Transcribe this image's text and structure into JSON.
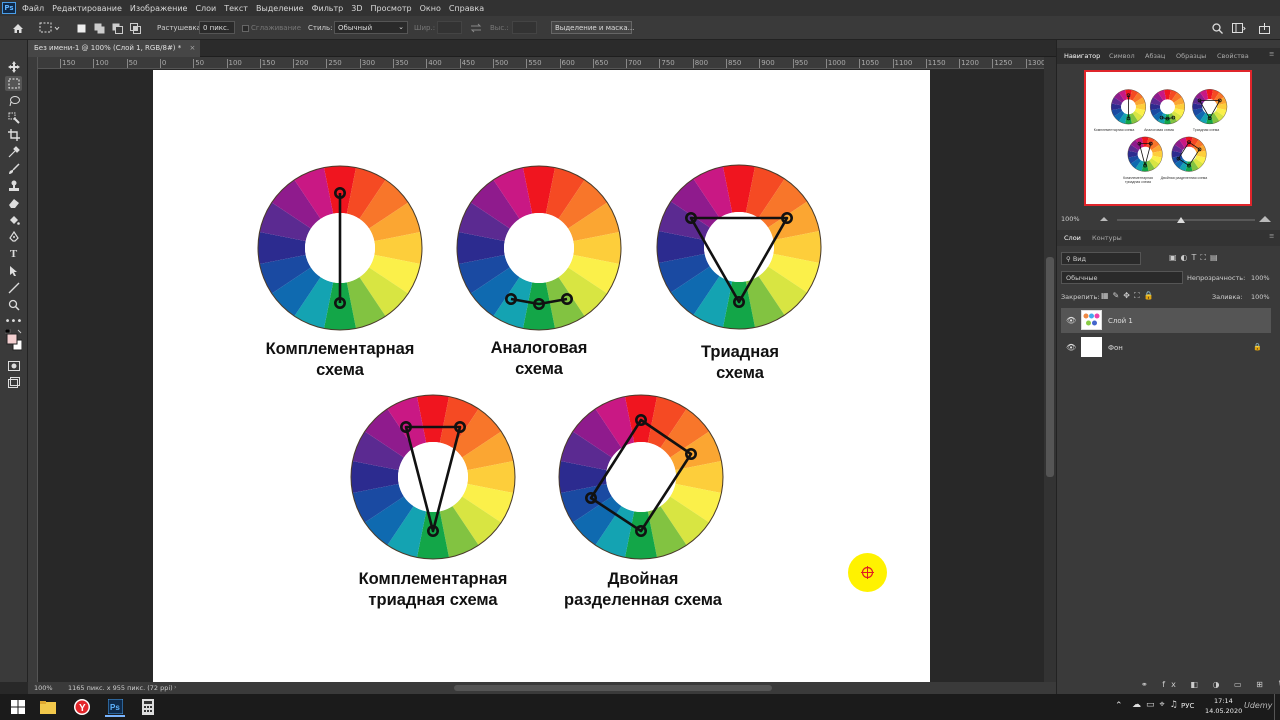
{
  "app": {
    "logo_text": "Ps"
  },
  "menu": [
    "Файл",
    "Редактирование",
    "Изображение",
    "Слои",
    "Текст",
    "Выделение",
    "Фильтр",
    "3D",
    "Просмотр",
    "Окно",
    "Справка"
  ],
  "options": {
    "feather_label": "Растушевка:",
    "feather_value": "0 пикс.",
    "antialias_label": "Сглаживание",
    "style_label": "Стиль:",
    "style_value": "Обычный",
    "width_label": "Шир.:",
    "height_label": "Выс.:",
    "select_mask_button": "Выделение и маска..."
  },
  "document": {
    "tab_title": "Без имени-1 @ 100% (Слой 1, RGB/8#) *",
    "close_symbol": "×"
  },
  "ruler": {
    "h_ticks": [
      "150",
      "100",
      "50",
      "0",
      "50",
      "100",
      "150",
      "200",
      "250",
      "300",
      "350",
      "400",
      "450",
      "500",
      "550",
      "600",
      "650",
      "700",
      "750",
      "800",
      "850",
      "900",
      "950",
      "1000",
      "1050",
      "1100",
      "1150",
      "1200",
      "1250",
      "1300"
    ]
  },
  "artwork": {
    "captions": [
      {
        "line1": "Комплементарная",
        "line2": "схема"
      },
      {
        "line1": "Аналоговая",
        "line2": "схема"
      },
      {
        "line1": "Триадная",
        "line2": "схема"
      },
      {
        "line1": "Комплементарная",
        "line2": "триадная схема"
      },
      {
        "line1": "Двойная",
        "line2": "разделенная схема"
      }
    ],
    "wheel_colors": [
      "#f0151f",
      "#f54a23",
      "#f8762a",
      "#fba632",
      "#fdce3b",
      "#fbf04a",
      "#d8e542",
      "#82c341",
      "#13a648",
      "#14a3b2",
      "#0f6ab0",
      "#1a4aa2",
      "#2c2b8f",
      "#5b2a91",
      "#8f1b8d",
      "#c91884"
    ]
  },
  "status": {
    "zoom": "100%",
    "doc_info": "1165 пикс. x 955 пикс. (72 ppi)"
  },
  "navigator": {
    "tabs": [
      "Навигатор",
      "Символ",
      "Абзац",
      "Образцы",
      "Свойства"
    ],
    "zoom": "100%",
    "thumb_captions": [
      "Комплементарная схема",
      "Аналоговая схема",
      "Триадная схема",
      "Комплементарная триадная схема",
      "Двойная разделенная схема"
    ]
  },
  "layers": {
    "tabs": [
      "Слои",
      "Контуры"
    ],
    "filter_label": "Вид",
    "blend_mode": "Обычные",
    "opacity_label": "Непрозрачность:",
    "opacity_value": "100%",
    "lock_label": "Закрепить:",
    "fill_label": "Заливка:",
    "fill_value": "100%",
    "items": [
      {
        "name": "Слой 1",
        "selected": true
      },
      {
        "name": "Фон",
        "selected": false
      }
    ]
  },
  "taskbar": {
    "lang": "РУС",
    "time": "17:14",
    "date": "14.05.2020",
    "watermark": "Udemy"
  }
}
